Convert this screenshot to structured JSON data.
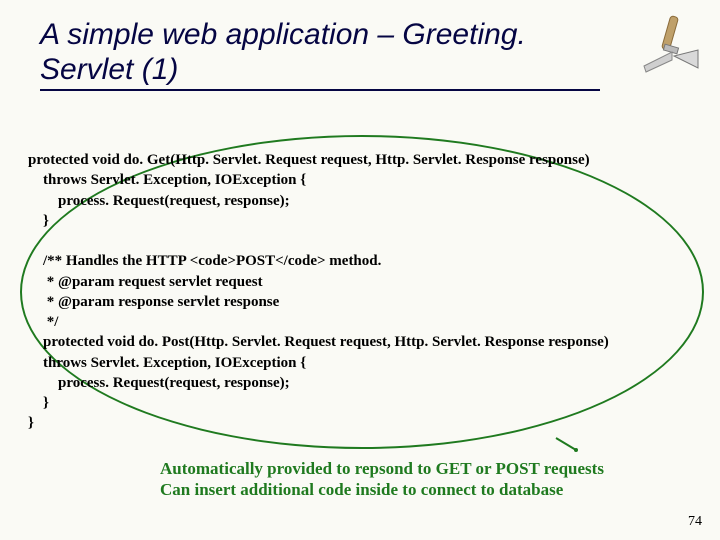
{
  "title": "A simple web application – Greeting. Servlet (1)",
  "code": "protected void do. Get(Http. Servlet. Request request, Http. Servlet. Response response)\n    throws Servlet. Exception, IOException {\n        process. Request(request, response);\n    }\n\n    /** Handles the HTTP <code>POST</code> method.\n     * @param request servlet request\n     * @param response servlet response\n     */\n    protected void do. Post(Http. Servlet. Request request, Http. Servlet. Response response)\n    throws Servlet. Exception, IOException {\n        process. Request(request, response);\n    }\n}",
  "annotation": "Automatically provided to repsond to GET or POST requests\nCan insert additional code inside to connect to database",
  "page_number": "74",
  "icon_name": "trowel-icon"
}
